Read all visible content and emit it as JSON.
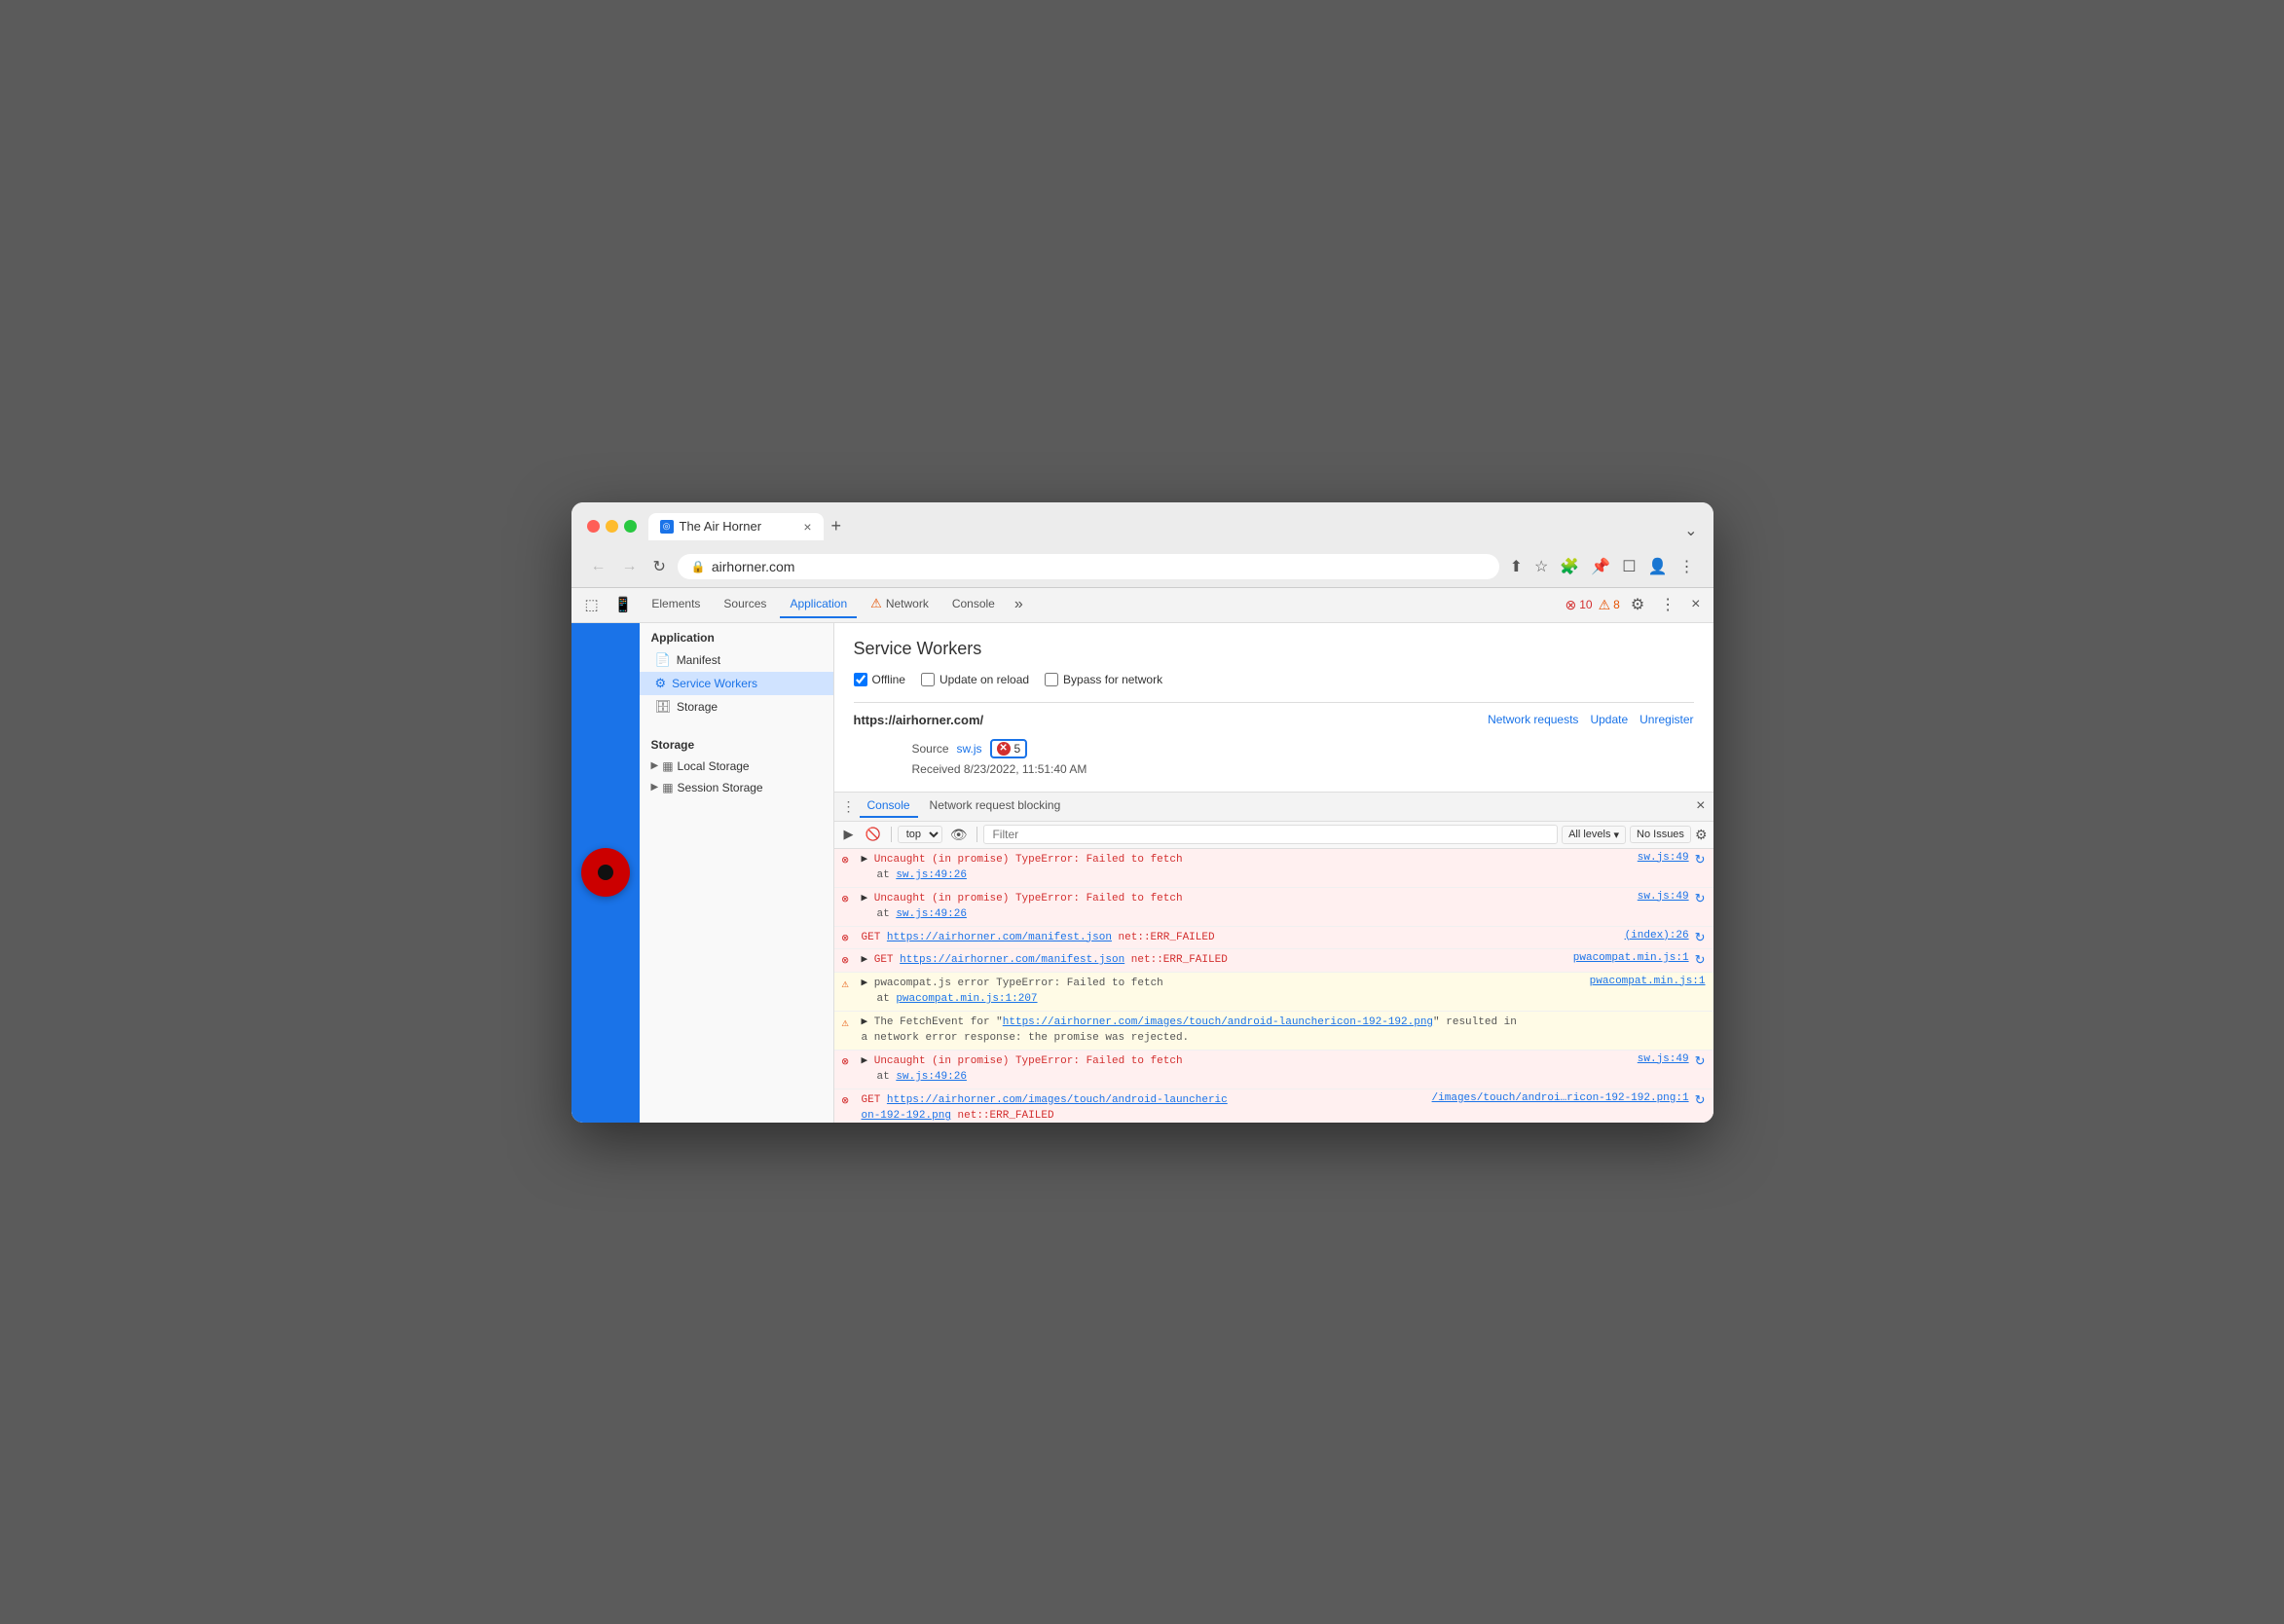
{
  "browser": {
    "tab_title": "The Air Horner",
    "tab_close": "×",
    "new_tab": "+",
    "overflow": "⌄",
    "url": "airhorner.com",
    "back": "←",
    "forward": "→",
    "reload": "↻"
  },
  "browser_actions": {
    "share": "⬆",
    "bookmark": "☆",
    "extensions": "🧩",
    "pin": "📌",
    "window": "☐",
    "profile": "👤",
    "menu": "⋮"
  },
  "devtools": {
    "tabs": [
      {
        "label": "Elements",
        "active": false
      },
      {
        "label": "Sources",
        "active": false
      },
      {
        "label": "Application",
        "active": true
      },
      {
        "label": "Network",
        "active": false,
        "warning": true
      },
      {
        "label": "Console",
        "active": false
      }
    ],
    "tab_more": "»",
    "error_count": "10",
    "warning_count": "8",
    "close": "×"
  },
  "sidebar": {
    "application_header": "Application",
    "items": [
      {
        "label": "Manifest",
        "icon": "📄"
      },
      {
        "label": "Service Workers",
        "icon": "⚙"
      },
      {
        "label": "Storage",
        "icon": "🗄"
      }
    ],
    "storage_header": "Storage",
    "storage_items": [
      {
        "label": "Local Storage",
        "icon": "▦"
      },
      {
        "label": "Session Storage",
        "icon": "▦"
      }
    ]
  },
  "service_workers_panel": {
    "title": "Service Workers",
    "offline_label": "Offline",
    "offline_checked": true,
    "update_on_reload_label": "Update on reload",
    "bypass_network_label": "Bypass for network",
    "origin": "https://airhorner.com/",
    "network_requests_link": "Network requests",
    "update_link": "Update",
    "unregister_link": "Unregister",
    "source_label": "Source",
    "source_file": "sw.js",
    "error_count": "5",
    "received_label": "Received 8/23/2022, 11:51:40 AM"
  },
  "console_panel": {
    "tabs": [
      {
        "label": "Console",
        "active": true
      },
      {
        "label": "Network request blocking",
        "active": false
      }
    ],
    "toolbar": {
      "play_label": "▶",
      "stop_label": "🚫",
      "context_label": "top",
      "eye_label": "👁",
      "filter_placeholder": "Filter",
      "all_levels": "All levels",
      "no_issues": "No Issues"
    },
    "log_entries": [
      {
        "type": "error",
        "expandable": true,
        "message": "Uncaught (in promise) TypeError: Failed to fetch",
        "sub_message": "at sw.js:49:26",
        "source": "sw.js:49",
        "has_reload": true
      },
      {
        "type": "error",
        "expandable": true,
        "message": "Uncaught (in promise) TypeError: Failed to fetch",
        "sub_message": "at sw.js:49:26",
        "source": "sw.js:49",
        "has_reload": true
      },
      {
        "type": "error",
        "expandable": false,
        "message": "GET https://airhorner.com/manifest.json net::ERR_FAILED",
        "sub_message": "",
        "source": "(index):26",
        "has_reload": true
      },
      {
        "type": "error",
        "expandable": true,
        "message": "GET https://airhorner.com/manifest.json net::ERR_FAILED",
        "sub_message": "",
        "source": "pwacompat.min.js:1",
        "has_reload": true
      },
      {
        "type": "warning",
        "expandable": true,
        "message": "pwacompat.js error TypeError: Failed to fetch",
        "sub_message": "at pwacompat.min.js:1:207",
        "source": "pwacompat.min.js:1",
        "has_reload": false
      },
      {
        "type": "warning",
        "expandable": true,
        "message": "The FetchEvent for \"https://airhorner.com/images/touch/android-launchericon-192-192.png\" resulted in a network error response: the promise was rejected.",
        "sub_message": "",
        "source": "",
        "has_reload": false
      },
      {
        "type": "error",
        "expandable": true,
        "message": "Uncaught (in promise) TypeError: Failed to fetch",
        "sub_message": "at sw.js:49:26",
        "source": "sw.js:49",
        "has_reload": true
      },
      {
        "type": "error",
        "expandable": false,
        "message": "GET https://airhorner.com/images/touch/android-launcheric on-192-192.png net::ERR_FAILED",
        "sub_message": "",
        "source": "/images/touch/androi…ricon-192-192.png:1",
        "has_reload": true
      }
    ],
    "prompt": ">"
  }
}
